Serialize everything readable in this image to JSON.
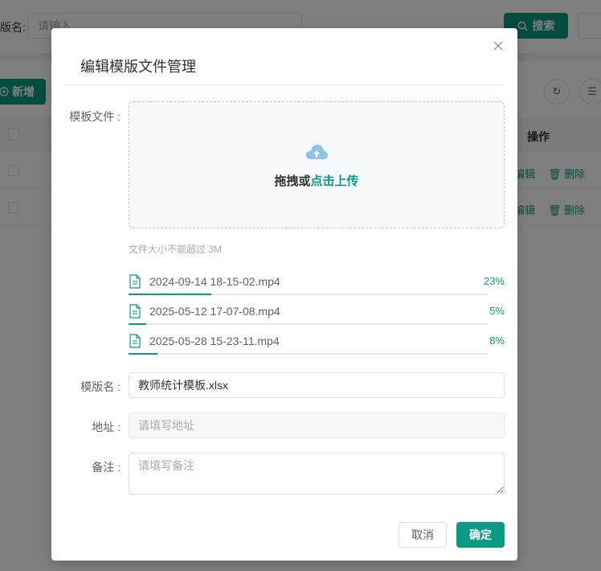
{
  "background": {
    "search_label": "版名:",
    "search_placeholder": "请输入",
    "search_button": "搜索",
    "add_button": "新增",
    "table_op_header": "操作",
    "rows": [
      {
        "edit": "编辑",
        "delete": "删除"
      },
      {
        "edit": "编辑",
        "delete": "删除"
      }
    ]
  },
  "dialog": {
    "title": "编辑模版文件管理",
    "template_file_label": "模板文件 :",
    "upload": {
      "text_prefix": "拖拽或",
      "text_link": "点击上传",
      "tip": "文件大小不能超过 3M"
    },
    "files": [
      {
        "name": "2024-09-14 18-15-02.mp4",
        "percent_label": "23%",
        "progress": 23
      },
      {
        "name": "2025-05-12 17-07-08.mp4",
        "percent_label": "5%",
        "progress": 5
      },
      {
        "name": "2025-05-28 15-23-11.mp4",
        "percent_label": "8%",
        "progress": 8
      }
    ],
    "template_name": {
      "label": "模版名 :",
      "value": "教师统计模板.xlsx"
    },
    "address": {
      "label": "地址 :",
      "placeholder": "请填写地址"
    },
    "remark": {
      "label": "备注 :",
      "placeholder": "请填写备注"
    },
    "cancel_button": "取消",
    "ok_button": "确定"
  },
  "colors": {
    "primary": "#0b9a82",
    "upload_icon": "#8fc3ea"
  }
}
